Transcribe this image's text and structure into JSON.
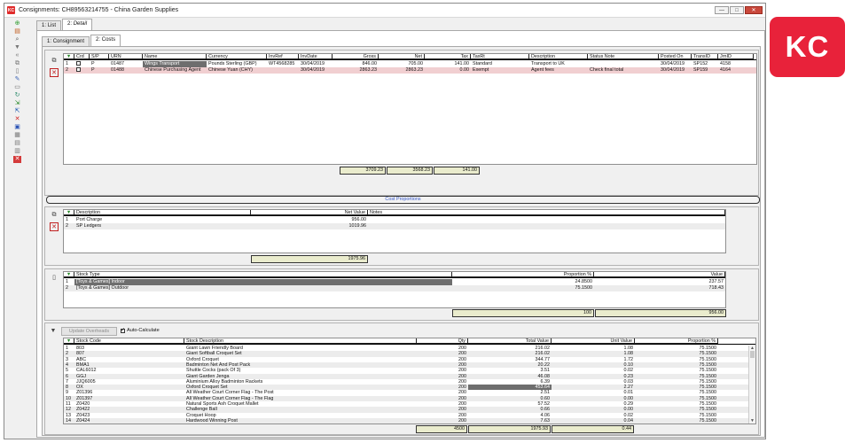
{
  "window": {
    "title": "Consignments: CH89563214755 - China Garden Supplies",
    "controls": [
      "—",
      "□",
      "✕"
    ]
  },
  "outer_tabs": [
    {
      "num": "1:",
      "label": "List"
    },
    {
      "num": "2:",
      "label": "Detail"
    }
  ],
  "inner_tabs": [
    {
      "num": "1:",
      "label": "Consignment"
    },
    {
      "num": "2:",
      "label": "Costs"
    }
  ],
  "costs": {
    "headers": [
      "Crd",
      "S/P",
      "URN",
      "Name",
      "Currency",
      "InvRef",
      "InvDate",
      "Gross",
      "Net",
      "Tax",
      "TaxRt",
      "Description",
      "Status Note",
      "Posted On",
      "TransID",
      "JrnID"
    ],
    "rows": [
      {
        "crd": "",
        "sp": "P",
        "urn": "01487",
        "name": "Wings Transport",
        "currency": "Pounds Sterling (GBP)",
        "invref": "WT4568285",
        "invdate": "30/04/2019",
        "gross": "846.00",
        "net": "705.00",
        "tax": "141.00",
        "taxrt": "Standard",
        "description": "Transport to UK",
        "status": "",
        "posted": "30/04/2019",
        "transid": "SP152",
        "jrnid": "4158"
      },
      {
        "crd": "",
        "sp": "P",
        "urn": "01488",
        "name": "Chinese Purchasing Agent",
        "currency": "Chinese Yuan (CHY)",
        "invref": "",
        "invdate": "30/04/2019",
        "gross": "2863.23",
        "net": "2863.23",
        "tax": "0.00",
        "taxrt": "Exempt",
        "description": "Agent fees",
        "status": "Check final total",
        "posted": "30/04/2019",
        "transid": "SP159",
        "jrnid": "4164"
      }
    ],
    "totals": {
      "gross": "3709.23",
      "net": "3568.23",
      "tax": "141.00"
    }
  },
  "cost_proportions_label": "Cost Proportions",
  "proportions": {
    "headers": [
      "Description",
      "Net Value",
      "Notes"
    ],
    "rows": [
      {
        "num": "1",
        "description": "Port Charge",
        "net": "956.00",
        "notes": ""
      },
      {
        "num": "2",
        "description": "SP Ledgers",
        "net": "1019.96",
        "notes": ""
      }
    ],
    "total": "1975.96"
  },
  "stock_types": {
    "headers": [
      "Stock Type",
      "Proportion %",
      "Value"
    ],
    "rows": [
      {
        "num": "1",
        "type": "[Toys & Games] Indoor",
        "proportion": "24.8500",
        "value": "237.57"
      },
      {
        "num": "2",
        "type": "[Toys & Games] Outdoor",
        "proportion": "75.1500",
        "value": "718.43"
      }
    ],
    "total_proportion": "100",
    "total_value": "956.00"
  },
  "overheads": {
    "update_button": "Update Overheads",
    "auto_calculate": "Auto-Calculate",
    "headers": [
      "Stock Code",
      "Stock Description",
      "Qty",
      "Total Value",
      "Unit Value",
      "Proportion %"
    ],
    "rows": [
      {
        "num": "1",
        "code": "803",
        "desc": "Giant Lawn Friendly Board",
        "qty": "200",
        "total": "216.02",
        "unit": "1.08",
        "prop": "75.1500"
      },
      {
        "num": "2",
        "code": "807",
        "desc": "Giant Softball Croquet Set",
        "qty": "200",
        "total": "216.02",
        "unit": "1.08",
        "prop": "75.1500"
      },
      {
        "num": "3",
        "code": "ABC",
        "desc": "Oxford Croquet",
        "qty": "200",
        "total": "344.77",
        "unit": "1.72",
        "prop": "75.1500"
      },
      {
        "num": "4",
        "code": "BMA1",
        "desc": "Badminton Net And Post Pack",
        "qty": "200",
        "total": "20.22",
        "unit": "0.10",
        "prop": "75.1500"
      },
      {
        "num": "5",
        "code": "CAL6012",
        "desc": "Shuttle Cocks (pack Of 3)",
        "qty": "200",
        "total": "3.51",
        "unit": "0.02",
        "prop": "75.1500"
      },
      {
        "num": "6",
        "code": "GGJ",
        "desc": "Giant Garden Jenga",
        "qty": "200",
        "total": "46.08",
        "unit": "0.23",
        "prop": "75.1500"
      },
      {
        "num": "7",
        "code": "JJQ6005",
        "desc": "Aluminium Alloy Badminton Rackets",
        "qty": "200",
        "total": "6.39",
        "unit": "0.03",
        "prop": "75.1500"
      },
      {
        "num": "8",
        "code": "OX",
        "desc": "Oxford Croquet Set",
        "qty": "200",
        "total": "453.64",
        "unit": "2.27",
        "prop": "75.1500"
      },
      {
        "num": "9",
        "code": "Z01396",
        "desc": "All Weather Court Corner Flag - The Post",
        "qty": "200",
        "total": "2.51",
        "unit": "0.01",
        "prop": "75.1500"
      },
      {
        "num": "10",
        "code": "Z01397",
        "desc": "All Weather Court Corner Flag - The Flag",
        "qty": "200",
        "total": "0.60",
        "unit": "0.00",
        "prop": "75.1500"
      },
      {
        "num": "11",
        "code": "Z0420",
        "desc": "Natural Sports Ash Croquet Mallet",
        "qty": "200",
        "total": "57.52",
        "unit": "0.29",
        "prop": "75.1500"
      },
      {
        "num": "12",
        "code": "Z0422",
        "desc": "Challenge Ball",
        "qty": "200",
        "total": "0.66",
        "unit": "0.00",
        "prop": "75.1500"
      },
      {
        "num": "13",
        "code": "Z0423",
        "desc": "Croquet Hoop",
        "qty": "200",
        "total": "4.06",
        "unit": "0.02",
        "prop": "75.1500"
      },
      {
        "num": "14",
        "code": "Z0424",
        "desc": "Hardwood Winning Post",
        "qty": "200",
        "total": "7.63",
        "unit": "0.04",
        "prop": "75.1500"
      }
    ],
    "totals": {
      "qty": "4500",
      "total": "1975.93",
      "unit": "0.44"
    }
  },
  "logo_text": "KC",
  "colors": {
    "accent": "#e8223a",
    "selection": "#6e6e6e",
    "totals": "#eaeccd",
    "pink_row": "#f1cfd1"
  }
}
